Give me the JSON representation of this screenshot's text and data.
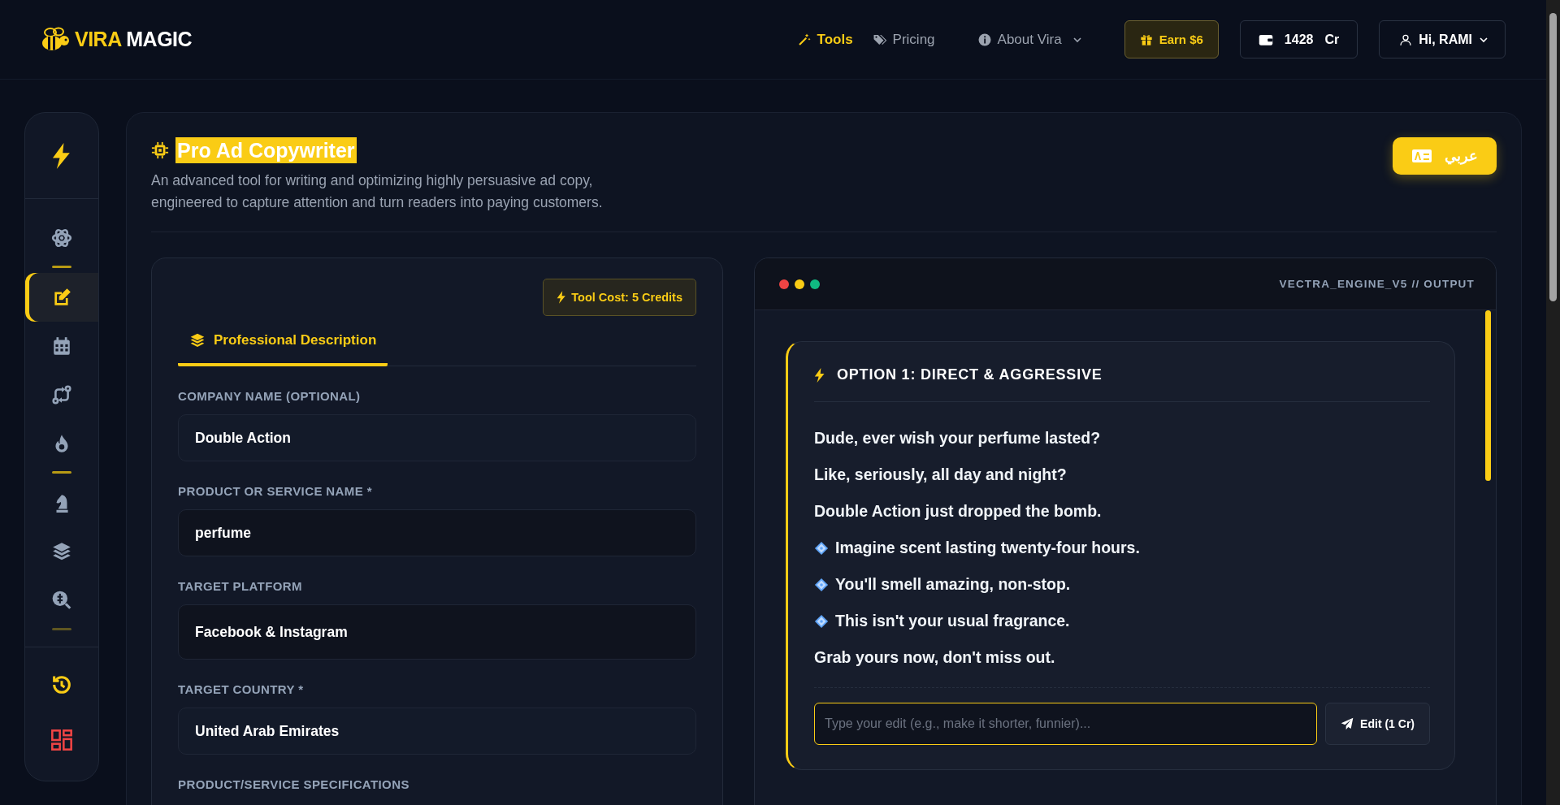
{
  "header": {
    "logo": {
      "part1": "VIRA",
      "part2": "MAGIC"
    },
    "nav": [
      {
        "label": "Tools",
        "kind": "wand",
        "selected": true
      },
      {
        "label": "Pricing",
        "kind": "tags",
        "selected": false
      },
      {
        "label": "About Vira",
        "kind": "info",
        "selected": false
      }
    ],
    "earn_button": "Earn $6",
    "credits": {
      "amount": "1428",
      "unit": "Cr"
    },
    "user_menu": "Hi, RAMI"
  },
  "sidebar": {
    "groups": [
      [
        {
          "kind": "atom",
          "selected": false
        }
      ],
      [
        {
          "kind": "edit",
          "selected": true
        },
        {
          "kind": "calendar",
          "selected": false
        },
        {
          "kind": "route",
          "selected": false
        },
        {
          "kind": "fire",
          "selected": false
        }
      ],
      [
        {
          "kind": "chess",
          "selected": false
        },
        {
          "kind": "layers",
          "selected": false
        },
        {
          "kind": "search-dollar",
          "selected": false
        }
      ]
    ]
  },
  "tool": {
    "title": "Pro Ad Copywriter",
    "description": "An advanced tool for writing and optimizing highly persuasive ad copy, engineered to capture attention and turn readers into paying customers.",
    "language_button": "عربي"
  },
  "form": {
    "cost": "Tool Cost: 5 Credits",
    "tabs": [
      {
        "label": "Professional Description",
        "selected": true
      }
    ],
    "fields": [
      {
        "label": "COMPANY NAME (OPTIONAL)",
        "value": "Double Action",
        "kind": "text"
      },
      {
        "label": "PRODUCT OR SERVICE NAME *",
        "value": "perfume",
        "kind": "text"
      },
      {
        "label": "TARGET PLATFORM",
        "value": "Facebook & Instagram",
        "kind": "select"
      },
      {
        "label": "TARGET COUNTRY *",
        "value": "United Arab Emirates",
        "kind": "text"
      },
      {
        "label": "PRODUCT/SERVICE SPECIFICATIONS",
        "kind": "label"
      }
    ]
  },
  "output": {
    "engine_label": "VECTRA_ENGINE_V5 // OUTPUT",
    "option_title": "OPTION 1: DIRECT & AGGRESSIVE",
    "lines": [
      {
        "text": "Dude, ever wish your perfume lasted?",
        "kind": "plain"
      },
      {
        "text": "Like, seriously, all day and night?",
        "kind": "plain"
      },
      {
        "text": "Double Action just dropped the bomb.",
        "kind": "plain"
      },
      {
        "text": "Imagine scent lasting twenty-four hours.",
        "kind": "bullet"
      },
      {
        "text": "You'll smell amazing, non-stop.",
        "kind": "bullet"
      },
      {
        "text": "This isn't your usual fragrance.",
        "kind": "bullet"
      },
      {
        "text": "Grab yours now, don't miss out.",
        "kind": "plain"
      }
    ],
    "edit_placeholder": "Type your edit (e.g., make it shorter, funnier)...",
    "edit_button": "Edit (1 Cr)"
  }
}
